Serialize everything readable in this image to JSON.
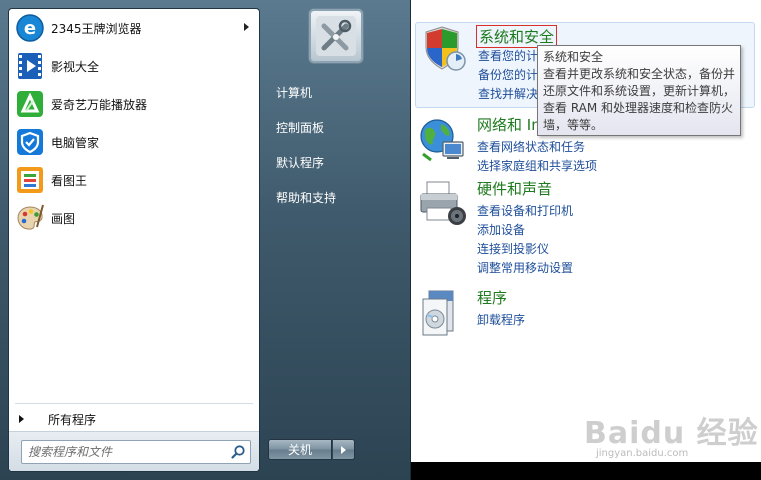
{
  "start_menu": {
    "programs": [
      {
        "label": "2345王牌浏览器",
        "icon": "browser-e-icon",
        "has_submenu": true
      },
      {
        "label": "影视大全",
        "icon": "video-film-icon",
        "has_submenu": false
      },
      {
        "label": "爱奇艺万能播放器",
        "icon": "iqiyi-player-icon",
        "has_submenu": false
      },
      {
        "label": "电脑管家",
        "icon": "shield-manager-icon",
        "has_submenu": false
      },
      {
        "label": "看图王",
        "icon": "image-viewer-icon",
        "has_submenu": false
      },
      {
        "label": "画图",
        "icon": "paint-palette-icon",
        "has_submenu": false
      }
    ],
    "all_programs_label": "所有程序",
    "search": {
      "placeholder": "搜索程序和文件"
    },
    "right_items": [
      {
        "label": "计算机"
      },
      {
        "label": "控制面板"
      },
      {
        "label": "默认程序"
      },
      {
        "label": "帮助和支持"
      }
    ],
    "shutdown_label": "关机"
  },
  "control_panel": {
    "sections": [
      {
        "title": "系统和安全",
        "icon": "security-shield-icon",
        "links": [
          "查看您的计",
          "备份您的计",
          "查找并解决"
        ]
      },
      {
        "title": "网络和 Internet",
        "icon": "network-globe-icon",
        "links": [
          "查看网络状态和任务",
          "选择家庭组和共享选项"
        ]
      },
      {
        "title": "硬件和声音",
        "icon": "printer-hardware-icon",
        "links": [
          "查看设备和打印机",
          "添加设备",
          "连接到投影仪",
          "调整常用移动设置"
        ]
      },
      {
        "title": "程序",
        "icon": "programs-box-icon",
        "links": [
          "卸载程序"
        ]
      }
    ],
    "tooltip": {
      "lines": [
        "系统和安全",
        "查看并更改系统和安全状态，备份并",
        "还原文件和系统设置，更新计算机，",
        "查看 RAM 和处理器速度和检查防火",
        "墙，等等。"
      ]
    }
  },
  "watermark": {
    "text": "Baidu 经验",
    "sub": "jingyan.baidu.com"
  },
  "colors": {
    "accent_green": "#1e7a1e",
    "link_blue": "#1e4e9a",
    "menu_dark": "#3f5a6c"
  }
}
